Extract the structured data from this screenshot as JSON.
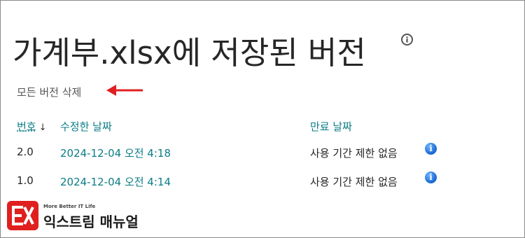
{
  "page": {
    "title": "가계부.xlsx에 저장된 버전",
    "title_info_icon": "info-circle-icon"
  },
  "actions": {
    "delete_all_label": "모든 버전 삭제",
    "annotation_arrow_color": "#e02020"
  },
  "table": {
    "columns": {
      "number": "번호",
      "modified_date": "수정한 날짜",
      "expiration_date": "만료 날짜"
    },
    "sort_icon": "sort-down-arrow-icon",
    "rows": [
      {
        "number": "2.0",
        "modified_date": "2024-12-04 오전 4:18",
        "expiration": "사용 기간 제한 없음"
      },
      {
        "number": "1.0",
        "modified_date": "2024-12-04 오전 4:14",
        "expiration": "사용 기간 제한 없음"
      }
    ]
  },
  "watermark": {
    "tagline": "More Better IT Life",
    "name": "익스트림 매뉴얼"
  },
  "colors": {
    "link": "#0b7d86",
    "info_blue": "#1766d1",
    "brand_red": "#e01f1f"
  }
}
